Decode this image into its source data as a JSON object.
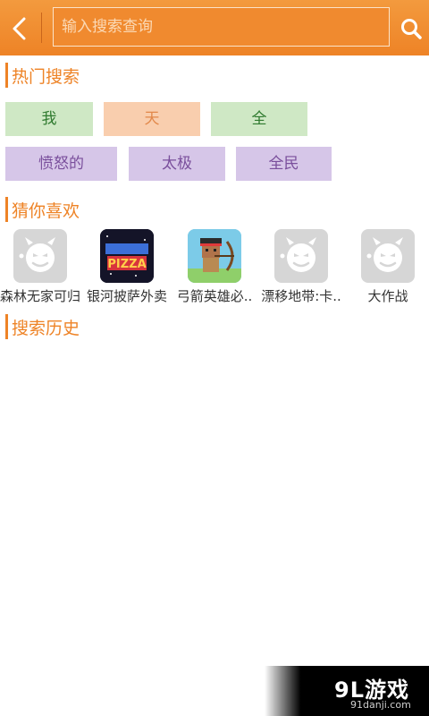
{
  "header": {
    "search_placeholder": "输入搜索查询",
    "accent_color": "#ee8326"
  },
  "hot_search": {
    "title": "热门搜索",
    "tags": [
      "我",
      "天",
      "全",
      "愤怒的",
      "太极",
      "全民"
    ]
  },
  "guess_you_like": {
    "title": "猜你喜欢",
    "games": [
      {
        "label": "森林无家可归",
        "icon": "placeholder-devil-icon"
      },
      {
        "label": "银河披萨外卖",
        "icon": "galactic-pizza-game-icon",
        "icon_text": "PIZZA"
      },
      {
        "label": "弓箭英雄必..",
        "icon": "archer-hero-game-icon"
      },
      {
        "label": "漂移地带:卡..",
        "icon": "placeholder-devil-icon"
      },
      {
        "label": "大作战",
        "icon": "placeholder-devil-icon"
      }
    ]
  },
  "search_history": {
    "title": "搜索历史"
  },
  "watermark": {
    "brand": "9L游戏",
    "domain": "91danji.com"
  }
}
